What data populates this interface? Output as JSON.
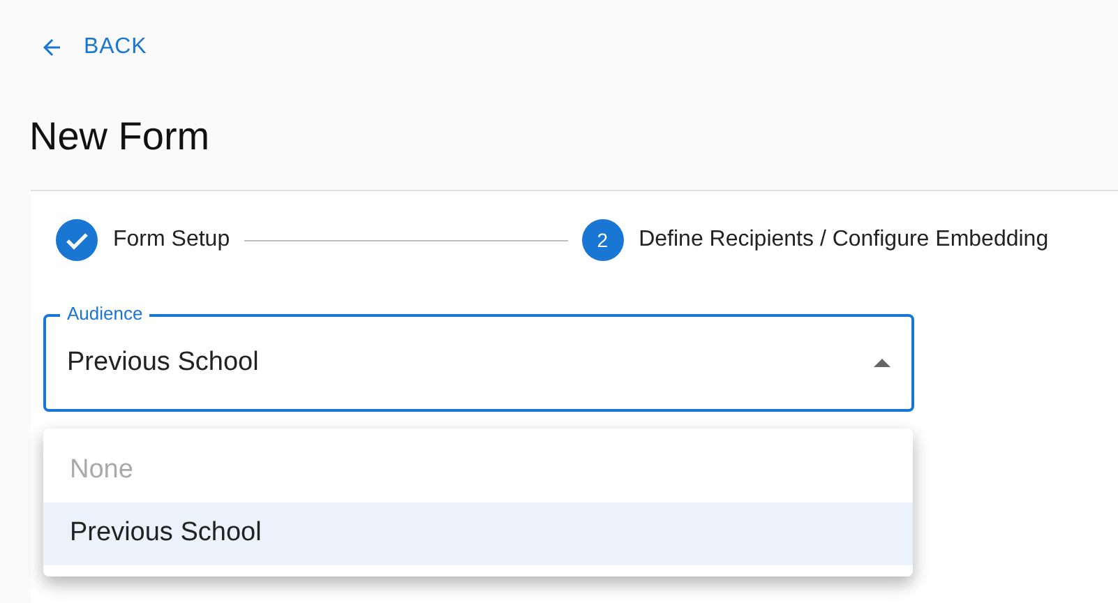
{
  "back": {
    "label": "BACK"
  },
  "title": "New Form",
  "steps": [
    {
      "label": "Form Setup",
      "completed": true
    },
    {
      "label": "Define Recipients / Configure Embedding",
      "number": "2",
      "completed": false
    }
  ],
  "audience": {
    "label": "Audience",
    "value": "Previous School",
    "expanded": true,
    "options": [
      {
        "label": "None",
        "disabled": true,
        "selected": false
      },
      {
        "label": "Previous School",
        "disabled": false,
        "selected": true
      }
    ]
  }
}
